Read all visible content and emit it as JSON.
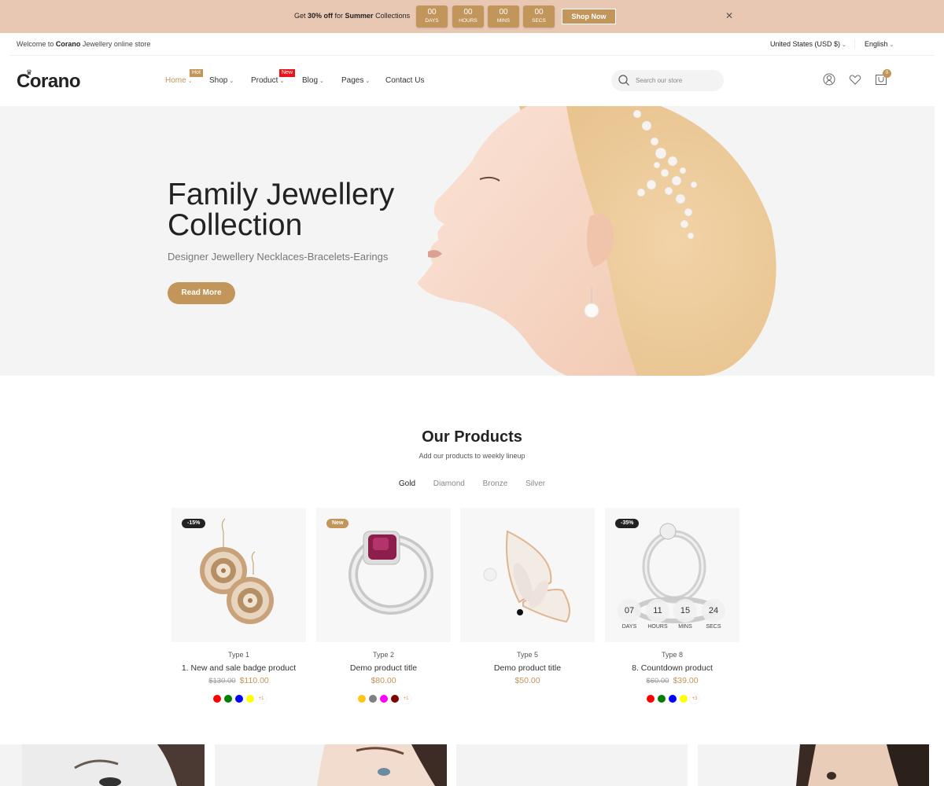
{
  "announcement": {
    "prefix": "Get ",
    "discount": "30% off",
    "middle": " for ",
    "highlight": "Summer",
    "suffix": " Collections",
    "countdown": [
      {
        "value": "00",
        "unit": "DAYS"
      },
      {
        "value": "00",
        "unit": "HOURS"
      },
      {
        "value": "00",
        "unit": "MINS"
      },
      {
        "value": "00",
        "unit": "SECS"
      }
    ],
    "cta_label": "Shop Now",
    "close_icon": "close-icon"
  },
  "topbar": {
    "welcome_prefix": "Welcome to ",
    "welcome_brand": "Corano",
    "welcome_suffix": " Jewellery online store",
    "currency": "United States (USD $)",
    "language": "English"
  },
  "header": {
    "logo": "Corano",
    "nav": [
      {
        "label": "Home",
        "badge": "Hot",
        "badge_color": "#c2955a",
        "active": true,
        "dropdown": true
      },
      {
        "label": "Shop",
        "dropdown": true
      },
      {
        "label": "Product",
        "badge": "New",
        "badge_color": "#e8151b",
        "dropdown": true
      },
      {
        "label": "Blog",
        "dropdown": true
      },
      {
        "label": "Pages",
        "dropdown": true
      },
      {
        "label": "Contact Us",
        "dropdown": false
      }
    ],
    "search_placeholder": "Search our store",
    "cart_count": "0"
  },
  "hero": {
    "title_line1": "Family Jewellery",
    "title_line2": "Collection",
    "subtitle": "Designer Jewellery Necklaces-Bracelets-Earings",
    "cta_label": "Read More"
  },
  "products": {
    "title": "Our Products",
    "subtitle": "Add our products to weekly lineup",
    "tabs": [
      "Gold",
      "Diamond",
      "Bronze",
      "Silver"
    ],
    "active_tab": "Gold",
    "items": [
      {
        "badge": "-15%",
        "badge_color": "#222222",
        "type": "Type 1",
        "name": "1. New and sale badge product",
        "old_price": "$130.00",
        "price": "$110.00",
        "swatches": [
          "#ff0000",
          "#008000",
          "#0000ff",
          "#ffff00"
        ],
        "more": "+1"
      },
      {
        "badge": "New",
        "badge_color": "#c2955a",
        "type": "Type 2",
        "name": "Demo product title",
        "old_price": "",
        "price": "$80.00",
        "swatches": [
          "#ffc61a",
          "#808080",
          "#ff00ff",
          "#800000"
        ],
        "more": "+1"
      },
      {
        "badge": "",
        "type": "Type 5",
        "name": "Demo product title",
        "old_price": "",
        "price": "$50.00",
        "swatches": [],
        "more": ""
      },
      {
        "badge": "-35%",
        "badge_color": "#222222",
        "type": "Type 8",
        "name": "8. Countdown product",
        "old_price": "$60.00",
        "price": "$39.00",
        "swatches": [
          "#ff0000",
          "#008000",
          "#0000ff",
          "#ffff00"
        ],
        "more": "+3",
        "countdown": [
          {
            "value": "07",
            "unit": "DAYS"
          },
          {
            "value": "11",
            "unit": "HOURS"
          },
          {
            "value": "15",
            "unit": "MINS"
          },
          {
            "value": "24",
            "unit": "SECS"
          }
        ]
      }
    ]
  }
}
